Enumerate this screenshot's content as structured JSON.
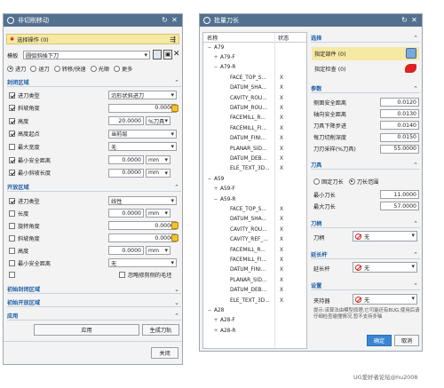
{
  "left": {
    "title": "非切削移动",
    "select_op": "选择操作 (0)",
    "template_label": "模板",
    "template_value": "圆弧斜插下刀",
    "tabs": [
      "进刀",
      "退刀",
      "转移/快速",
      "光顺",
      "更多"
    ],
    "sec1": "封闭区域",
    "sec1_rows": [
      {
        "label": "进刀类型",
        "checked": true,
        "value": "沿形状斜进刀"
      },
      {
        "label": "斜坡角度",
        "checked": true,
        "value": "0.0000"
      },
      {
        "label": "高度",
        "checked": true,
        "value": "20.0000",
        "unit": "%刀具"
      },
      {
        "label": "高度起点",
        "checked": true,
        "value": "当前层"
      },
      {
        "label": "最大宽度",
        "checked": false,
        "value": "无"
      },
      {
        "label": "最小安全距离",
        "checked": true,
        "value": "0.0000",
        "unit": "mm"
      },
      {
        "label": "最小斜坡长度",
        "checked": true,
        "value": "0.0000",
        "unit": "mm"
      }
    ],
    "sec2": "开放区域",
    "sec2_rows": [
      {
        "label": "进刀类型",
        "checked": true,
        "value": "线性"
      },
      {
        "label": "长度",
        "checked": false,
        "value": "0.0000",
        "unit": "mm"
      },
      {
        "label": "旋转角度",
        "checked": false,
        "value": "0.0000"
      },
      {
        "label": "斜坡角度",
        "checked": false,
        "value": "0.0000"
      },
      {
        "label": "高度",
        "checked": false,
        "value": "0.0000",
        "unit": "mm"
      },
      {
        "label": "最小安全距离",
        "checked": false,
        "value": "无"
      }
    ],
    "trim_label": "忽略修剪侧的毛坯",
    "sec3": "初始封闭区域",
    "sec4": "初始开放区域",
    "sec5": "应用",
    "apply_btn": "应用",
    "gen_btn": "生成刀轨",
    "close_btn": "关闭"
  },
  "right": {
    "title": "批量刀长",
    "col_name": "名称",
    "col_status": "状态",
    "tree": [
      {
        "lvl": 0,
        "name": "A79",
        "exp": "−"
      },
      {
        "lvl": 1,
        "name": "A79-F",
        "exp": "+"
      },
      {
        "lvl": 1,
        "name": "A79-R",
        "exp": "−"
      },
      {
        "lvl": 2,
        "name": "FACE_TOP_S...",
        "st": "X"
      },
      {
        "lvl": 2,
        "name": "DATUM_SHA...",
        "st": "X"
      },
      {
        "lvl": 2,
        "name": "CAVITY_ROU...",
        "st": "X"
      },
      {
        "lvl": 2,
        "name": "DATUM_ROU...",
        "st": "X"
      },
      {
        "lvl": 2,
        "name": "FACEMILL_R...",
        "st": "X"
      },
      {
        "lvl": 2,
        "name": "FACEMILL_FI...",
        "st": "X"
      },
      {
        "lvl": 2,
        "name": "DATUM_FINI...",
        "st": "X"
      },
      {
        "lvl": 2,
        "name": "PLANAR_SID...",
        "st": "X"
      },
      {
        "lvl": 2,
        "name": "DATUM_DEB...",
        "st": "X"
      },
      {
        "lvl": 2,
        "name": "ELE_TEXT_3D...",
        "st": "X"
      },
      {
        "lvl": 0,
        "name": "A59",
        "exp": "−"
      },
      {
        "lvl": 1,
        "name": "A59-F",
        "exp": "+"
      },
      {
        "lvl": 1,
        "name": "A59-R",
        "exp": "−"
      },
      {
        "lvl": 2,
        "name": "FACE_TOP_S...",
        "st": "X"
      },
      {
        "lvl": 2,
        "name": "DATUM_SHA...",
        "st": "X"
      },
      {
        "lvl": 2,
        "name": "CAVITY_ROU...",
        "st": "X"
      },
      {
        "lvl": 2,
        "name": "CAVITY_REF_...",
        "st": "X"
      },
      {
        "lvl": 2,
        "name": "FACEMILL_R...",
        "st": "X"
      },
      {
        "lvl": 2,
        "name": "FACEMILL_FI...",
        "st": "X"
      },
      {
        "lvl": 2,
        "name": "DATUM_FINI...",
        "st": "X"
      },
      {
        "lvl": 2,
        "name": "PLANAR_SID...",
        "st": "X"
      },
      {
        "lvl": 2,
        "name": "DATUM_DEB...",
        "st": "X"
      },
      {
        "lvl": 2,
        "name": "ELE_TEXT_3D...",
        "st": "X"
      },
      {
        "lvl": 0,
        "name": "A28",
        "exp": "−"
      },
      {
        "lvl": 1,
        "name": "A28-F",
        "exp": "+"
      },
      {
        "lvl": 1,
        "name": "A28-R",
        "exp": "+"
      }
    ],
    "sel_head": "选择",
    "sel_part": "指定部件 (0)",
    "sel_check": "指定检查 (0)",
    "param_head": "参数",
    "params": [
      {
        "label": "侧面安全距离",
        "value": "0.0120"
      },
      {
        "label": "轴向安全距离",
        "value": "0.0130"
      },
      {
        "label": "刀具下降步进",
        "value": "0.0140"
      },
      {
        "label": "每刀切削深度",
        "value": "0.0150"
      },
      {
        "label": "刀刃采样(%刀具)",
        "value": "55.0000"
      }
    ],
    "tool_head": "刀具",
    "radio_fixed": "固定刀长",
    "radio_range": "刀长范围",
    "min_len_label": "最小刀长",
    "min_len": "11.0000",
    "max_len_label": "最大刀长",
    "max_len": "57.0000",
    "holder_head": "刀柄",
    "holder_label": "刀柄",
    "holder_value": "无",
    "ext_head": "延长杆",
    "ext_label": "延长杆",
    "ext_value": "无",
    "set_head": "设置",
    "chuck_label": "夹持器",
    "chuck_value": "无",
    "note": "提示:该算法由模型原理,它可能还有BUG,使用后请仔细检查碰撞情况,暂不支持多轴",
    "ok": "确定",
    "cancel": "取消"
  },
  "watermark": "UG爱好者论坛@hu2008"
}
